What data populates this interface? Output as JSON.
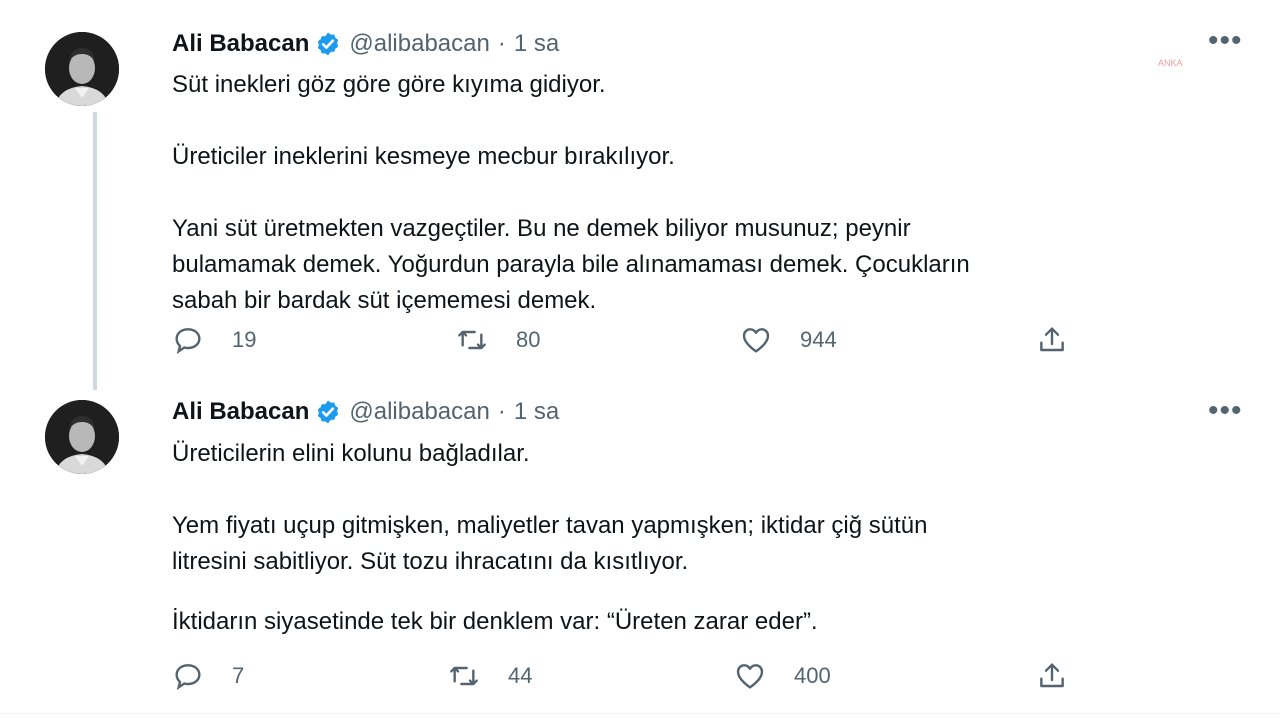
{
  "watermark": "ANKA",
  "tweets": [
    {
      "name": "Ali Babacan",
      "handle": "@alibabacan",
      "separator": "·",
      "time": "1 sa",
      "more": "•••",
      "paragraphs": [
        "Süt inekleri göz göre göre kıyıma gidiyor.",
        "Üreticiler ineklerini kesmeye mecbur bırakılıyor.",
        "Yani süt üretmekten vazgeçtiler. Bu ne demek biliyor musunuz; peynir\nbulamamak demek. Yoğurdun parayla bile alınamaması demek. Çocukların\nsabah bir bardak süt içememesi demek."
      ],
      "replies": "19",
      "retweets": "80",
      "likes": "944"
    },
    {
      "name": "Ali Babacan",
      "handle": "@alibabacan",
      "separator": "·",
      "time": "1 sa",
      "more": "•••",
      "paragraphs": [
        "Üreticilerin elini kolunu bağladılar.",
        "Yem fiyatı uçup gitmişken, maliyetler tavan yapmışken; iktidar çiğ sütün\nlitresini sabitliyor. Süt tozu ihracatını da kısıtlıyor.",
        "İktidarın siyasetinde tek bir denklem var: “Üreten zarar eder”."
      ],
      "replies": "7",
      "retweets": "44",
      "likes": "400"
    }
  ],
  "colors": {
    "verified": "#1d9bf0",
    "muted": "#536471",
    "text": "#0f1419",
    "thread_line": "#cfd9de"
  },
  "icons": [
    "verified-badge-icon",
    "more-icon",
    "reply-icon",
    "retweet-icon",
    "like-icon",
    "share-icon"
  ]
}
